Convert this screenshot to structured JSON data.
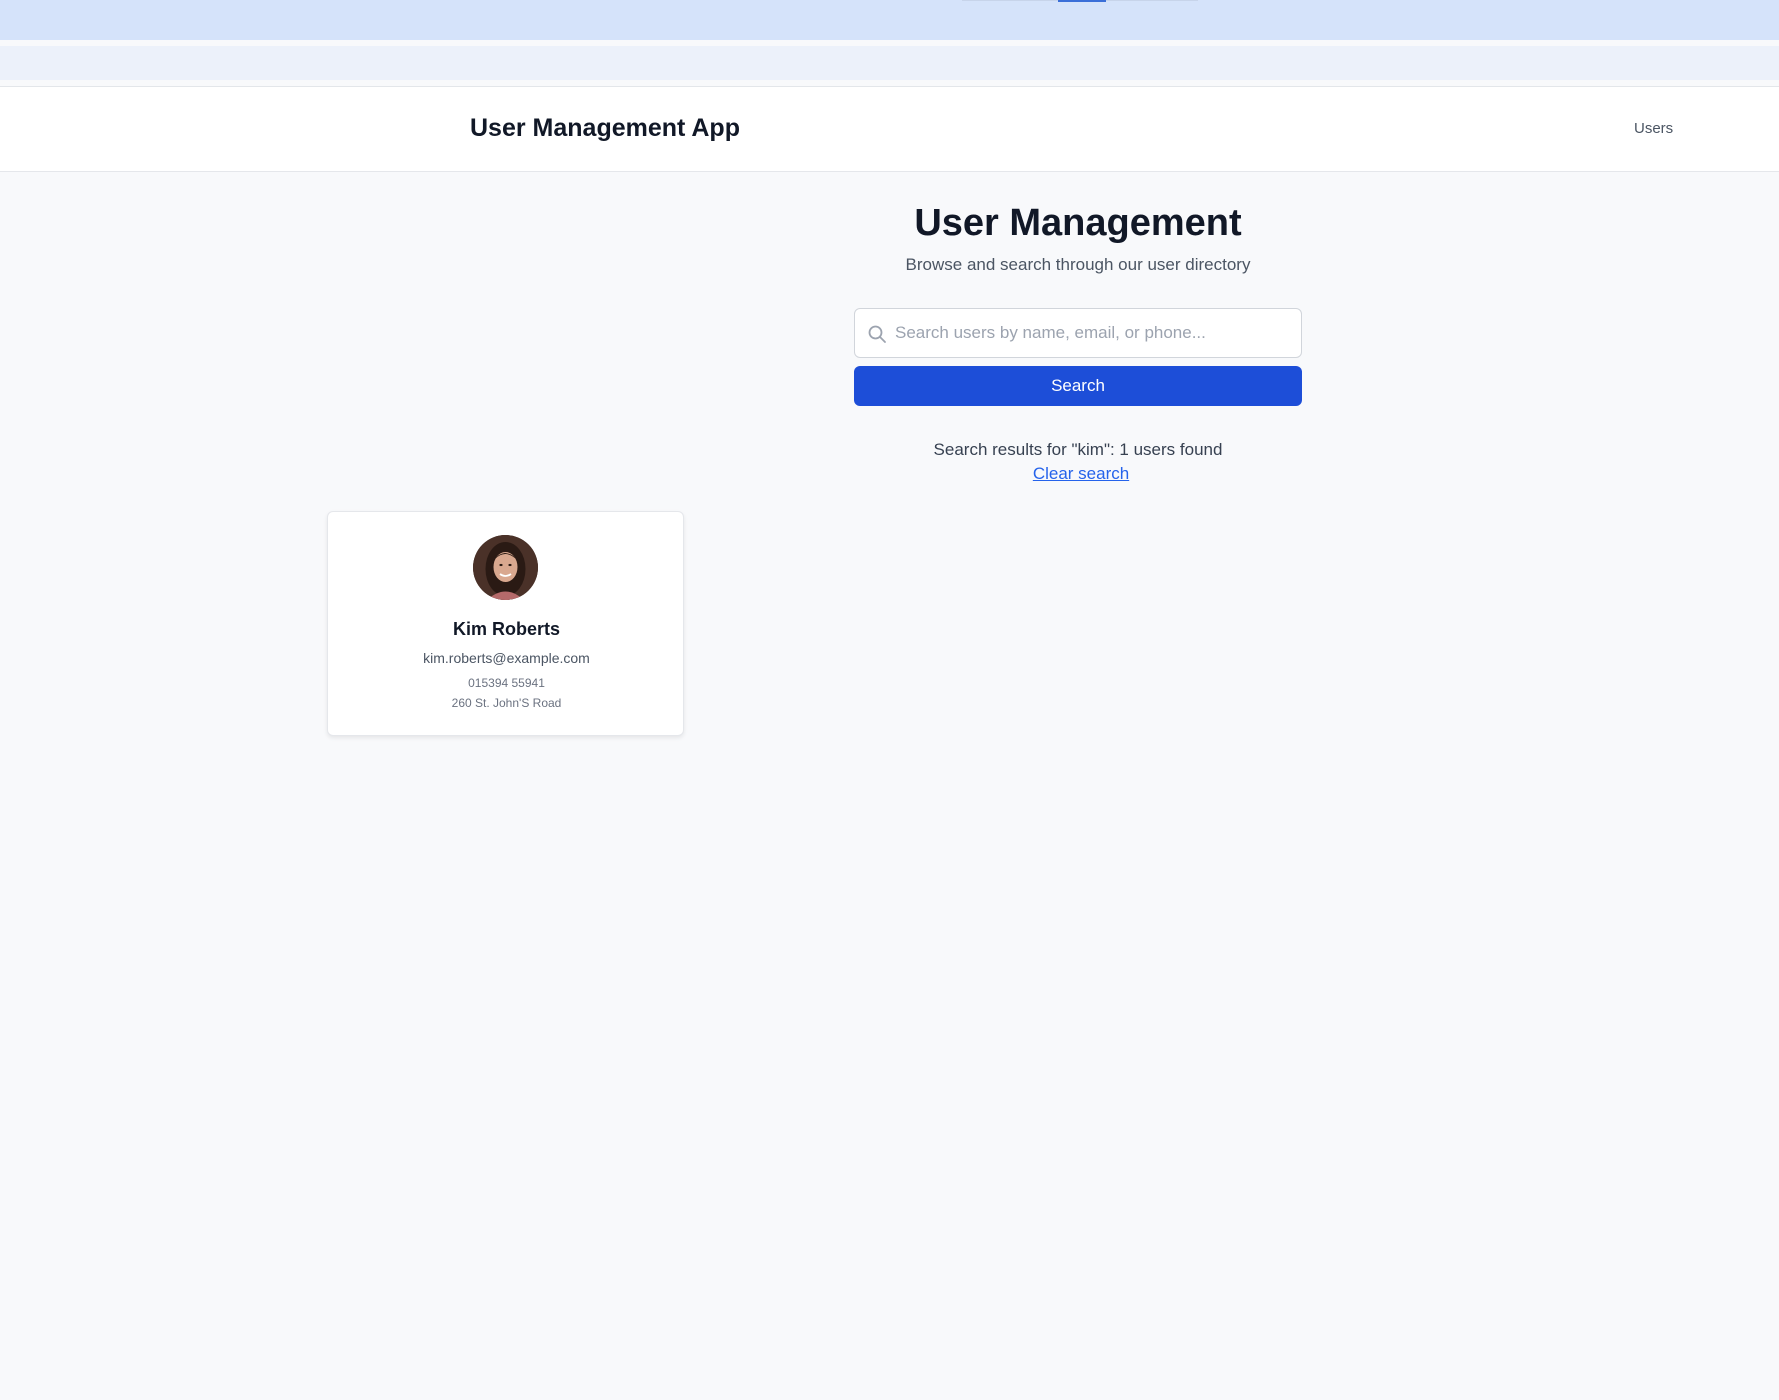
{
  "header": {
    "app_title": "User Management App",
    "nav_users": "Users"
  },
  "main": {
    "title": "User Management",
    "subtitle": "Browse and search through our user directory"
  },
  "search": {
    "placeholder": "Search users by name, email, or phone...",
    "value": "",
    "button_label": "Search",
    "icon": "search-icon"
  },
  "results": {
    "summary": "Search results for \"kim\": 1 users found",
    "clear_label": "Clear search"
  },
  "users": [
    {
      "name": "Kim Roberts",
      "email": "kim.roberts@example.com",
      "phone": "015394 55941",
      "address": "260 St. John'S Road"
    }
  ],
  "colors": {
    "primary": "#1d4ed8",
    "link": "#2563eb",
    "top_band": "#d5e3fa",
    "page_bg": "#f8f9fb"
  }
}
